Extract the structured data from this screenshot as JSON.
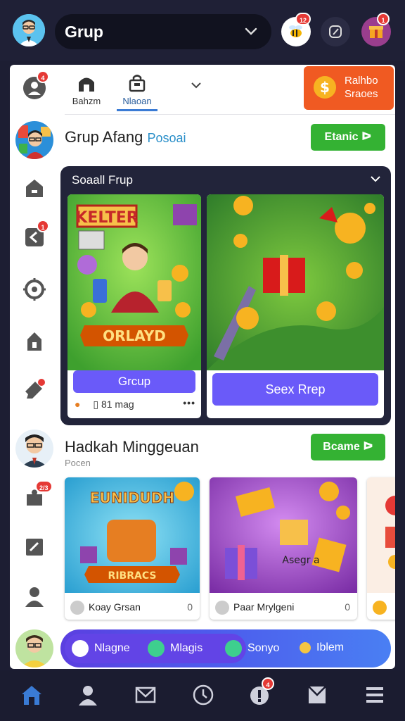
{
  "header": {
    "group_select": "Grup",
    "badges": {
      "notif": "12",
      "gift": "1"
    }
  },
  "tabs": [
    {
      "label": "Bahzm",
      "active": false
    },
    {
      "label": "Nlaoan",
      "active": true
    }
  ],
  "rewards_button": {
    "label_1": "Ralhbo",
    "label_2": "Sraoes"
  },
  "rail_badges": {
    "first": "4",
    "third": "1"
  },
  "group_1": {
    "title": "Grup Afang",
    "accent": "Posoai",
    "join_label": "Etanic ᐅ"
  },
  "social_card": {
    "title": "Soaall Frup",
    "card_1": {
      "banner": "KELTER",
      "ribbon": "ORLAYD",
      "button": "Grcup",
      "meta": "81 mag",
      "more": "•••"
    },
    "card_2": {
      "button": "Seex Rrep"
    }
  },
  "group_2": {
    "title": "Hadkah Minggeuan",
    "subtitle": "Pocen",
    "join_label": "Bcame ᐅ"
  },
  "thumbs": [
    {
      "banner": "EUNIDUDH",
      "ribbon": "RIBRACS",
      "owner": "Koay Grsan",
      "count": "0"
    },
    {
      "owner": "Paar Mrylgeni",
      "count": "0",
      "caption": "Asegr a"
    },
    {
      "owner": "",
      "count": ""
    }
  ],
  "chips": [
    {
      "label": "Nlagne",
      "color": "#ffffff"
    },
    {
      "label": "Mlagis",
      "color": "#3ecf8e"
    },
    {
      "label": "Sonyo",
      "color": "#3ecf8e"
    },
    {
      "label": "Iblem",
      "color": "#f5c542"
    }
  ],
  "rail_badge_bottom": "2/3",
  "nav": [
    "home",
    "profile",
    "mail",
    "clock",
    "alerts",
    "inbox",
    "menu"
  ],
  "nav_badge": "4",
  "colors": {
    "accent_orange": "#f05a22",
    "accent_green": "#34b233",
    "accent_purple": "#6a5af9",
    "nav_active": "#3a7bd5"
  }
}
